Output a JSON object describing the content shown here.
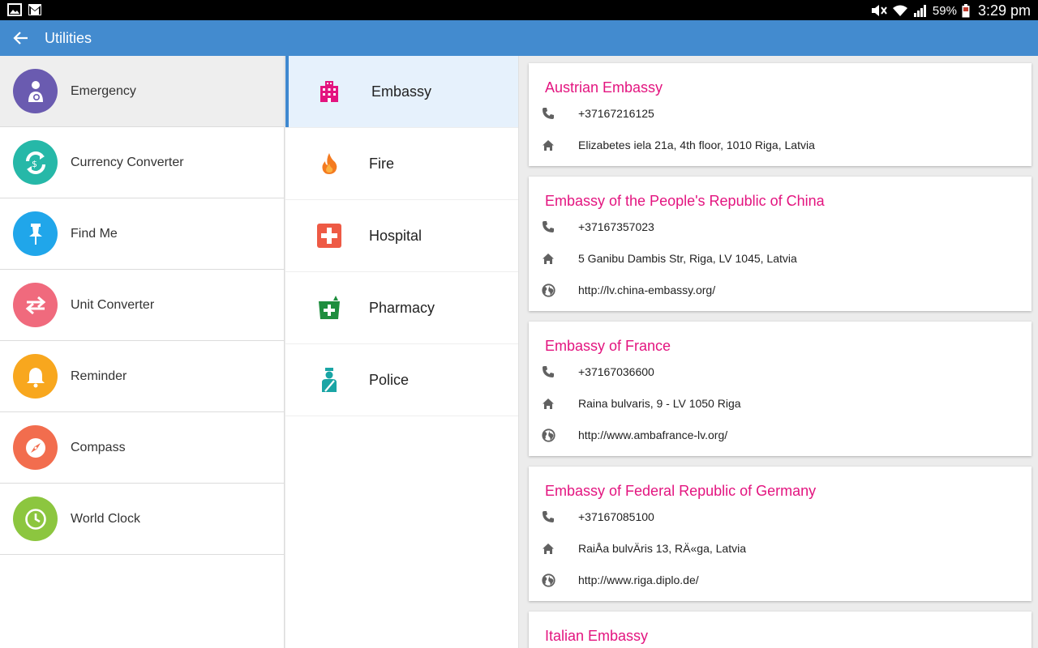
{
  "status_bar": {
    "battery": "59%",
    "time": "3:29 pm"
  },
  "app_bar": {
    "title": "Utilities"
  },
  "menu": {
    "items": [
      {
        "label": "Emergency",
        "icon": "emergency-icon",
        "color": "#6a5bb0"
      },
      {
        "label": "Currency Converter",
        "icon": "currency-icon",
        "color": "#26b8a8"
      },
      {
        "label": "Find Me",
        "icon": "pin-icon",
        "color": "#20a6ea"
      },
      {
        "label": "Unit Converter",
        "icon": "arrows-icon",
        "color": "#f06a7d"
      },
      {
        "label": "Reminder",
        "icon": "bell-icon",
        "color": "#f8a71e"
      },
      {
        "label": "Compass",
        "icon": "compass-icon",
        "color": "#f26d4e"
      },
      {
        "label": "World Clock",
        "icon": "clock-icon",
        "color": "#8cc63f"
      }
    ]
  },
  "categories": {
    "items": [
      {
        "label": "Embassy",
        "icon": "building-icon",
        "color": "#e3147f"
      },
      {
        "label": "Fire",
        "icon": "fire-icon",
        "color": "#f47b20"
      },
      {
        "label": "Hospital",
        "icon": "hospital-icon",
        "color": "#ee5a45"
      },
      {
        "label": "Pharmacy",
        "icon": "pharmacy-icon",
        "color": "#1e8e3e"
      },
      {
        "label": "Police",
        "icon": "police-icon",
        "color": "#1aa5a5"
      }
    ]
  },
  "embassies": [
    {
      "name": "Austrian Embassy",
      "phone": "+37167216125",
      "address": "Elizabetes iela 21a, 4th floor, 1010 Riga, Latvia"
    },
    {
      "name": "Embassy of the People's Republic of China",
      "phone": "+37167357023",
      "address": "5 Ganibu Dambis Str, Riga, LV 1045, Latvia",
      "website": "http://lv.china-embassy.org/"
    },
    {
      "name": "Embassy of France",
      "phone": "+37167036600",
      "address": "Raina bulvaris, 9 - LV 1050 Riga",
      "website": "http://www.ambafrance-lv.org/"
    },
    {
      "name": "Embassy of Federal Republic of Germany",
      "phone": "+37167085100",
      "address": "RaiÅa bulvÄris 13, RÄ«ga, Latvia",
      "website": "http://www.riga.diplo.de/"
    },
    {
      "name": "Italian Embassy"
    }
  ]
}
